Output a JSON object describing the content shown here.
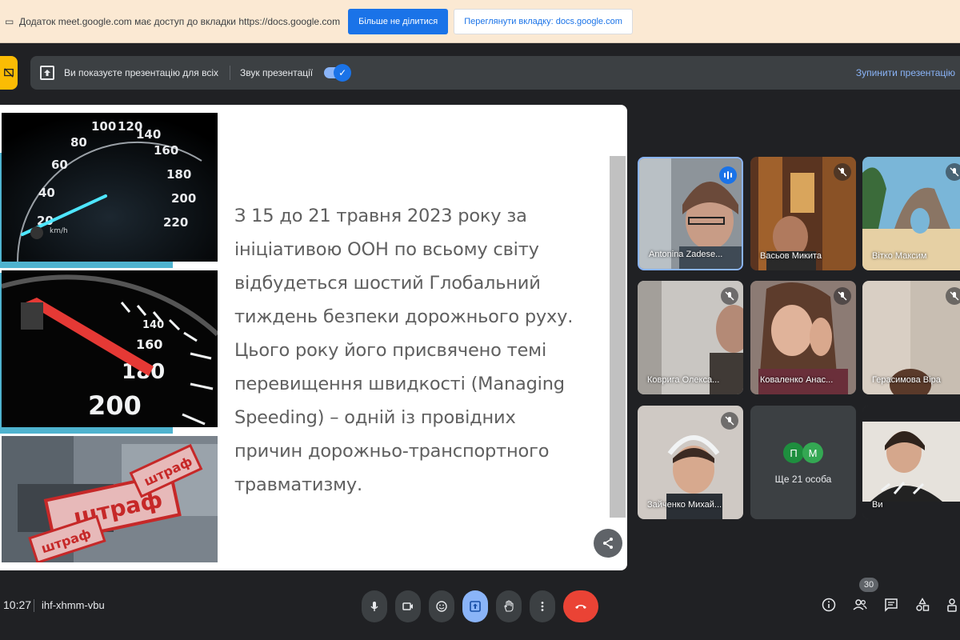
{
  "share_bar": {
    "text": "Додаток meet.google.com має доступ до вкладки https://docs.google.com",
    "stop_sharing_label": "Більше не ділитися",
    "view_tab_label": "Переглянути вкладку: docs.google.com"
  },
  "present_bar": {
    "presenting_text": "Ви показуєте презентацію для всіх",
    "audio_label": "Звук презентації",
    "audio_on": true,
    "stop_label": "Зупинити презентацію"
  },
  "slide": {
    "text": "З 15 до 21 травня 2023 року за ініціативою ООН по всьому світу відбудеться шостий Глобальний тиждень безпеки дорожнього руху. Цього року його присвячено темі перевищення швидкості (Managing Speeding) – одній із провідних причин дорожньо-транспортного травматизму.",
    "lines": [
      "З 15 до 21 травня 2023 року за",
      "ініціативою ООН по всьому світу",
      "відбудеться шостий Глобальний",
      "тиждень безпеки дорожнього руху.",
      "Цього року його присвячено темі",
      "перевищення швидкості (Managing",
      "Speeding) – одній із провідних",
      "причин дорожньо-транспортного",
      "травматизму."
    ],
    "speedometer1_ticks": [
      "20",
      "40",
      "60",
      "80",
      "100",
      "120",
      "140",
      "160",
      "180",
      "200",
      "220"
    ],
    "speedometer1_unit": "km/h",
    "speedometer2_ticks": [
      "140",
      "160",
      "180",
      "200"
    ],
    "stamp_text": "штраф"
  },
  "participants": [
    {
      "name": "Antonina Zadese...",
      "speaking": true
    },
    {
      "name": "Васьов Микита",
      "muted": true
    },
    {
      "name": "Вітко Максим",
      "muted": true
    },
    {
      "name": "Коврига Олекса...",
      "muted": true
    },
    {
      "name": "Коваленко Анас...",
      "muted": true
    },
    {
      "name": "Герасимова Віра",
      "muted": true
    },
    {
      "name": "Зайченко Михай...",
      "muted": true
    },
    {
      "name": "Ви"
    }
  ],
  "more_tile": {
    "avatars": [
      {
        "letter": "П",
        "color": "#1e8e3e"
      },
      {
        "letter": "М",
        "color": "#34a853"
      }
    ],
    "label": "Ще 21 особа"
  },
  "bottom_bar": {
    "time": "10:27",
    "meeting_code": "ihf-xhmm-vbu",
    "participant_count": "30"
  },
  "colors": {
    "accent": "#1a73e8",
    "hangup": "#ea4335",
    "present_active": "#8ab4f8",
    "banner_bg": "#fbe9d3"
  }
}
